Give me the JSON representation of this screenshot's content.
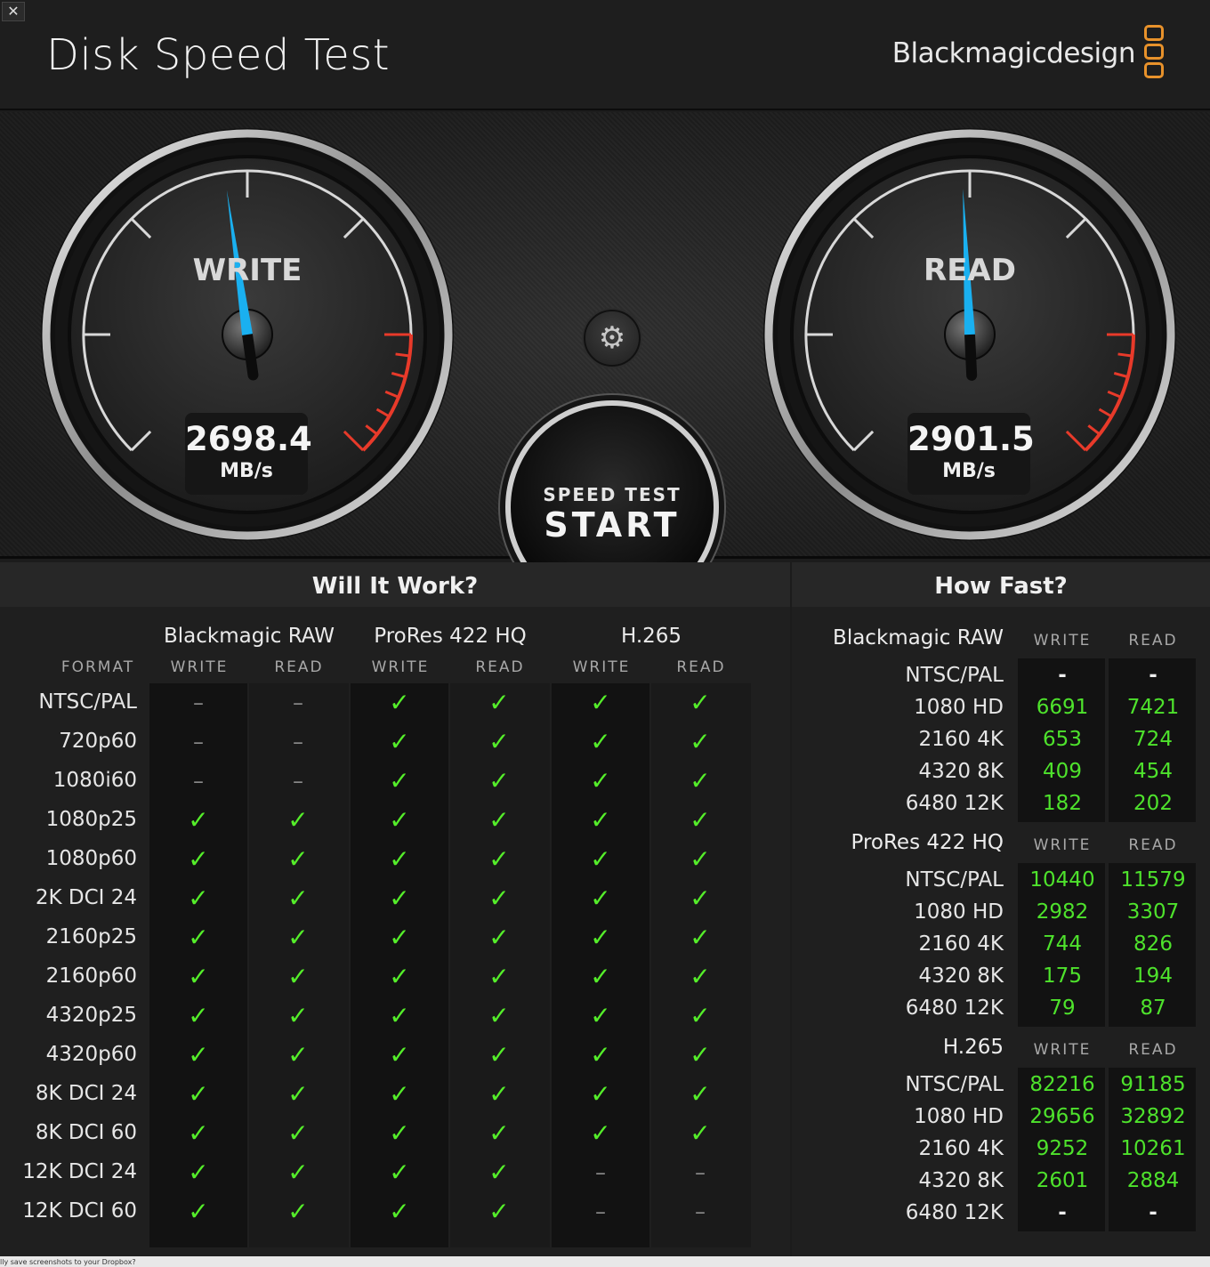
{
  "window": {
    "close_glyph": "✕",
    "title": "Disk Speed Test",
    "brand": "Blackmagicdesign"
  },
  "gauges": {
    "write": {
      "label": "WRITE",
      "value": "2698.4",
      "unit": "MB/s",
      "needle_fraction": 0.47
    },
    "read": {
      "label": "READ",
      "value": "2901.5",
      "unit": "MB/s",
      "needle_fraction": 0.49
    }
  },
  "controls": {
    "settings_icon": "gear-icon",
    "settings_glyph": "⚙",
    "start_line1": "SPEED TEST",
    "start_line2": "START"
  },
  "colors": {
    "needle": "#1ab0f0",
    "check": "#55ee2a",
    "value": "#4ee22c",
    "redline": "#e83a2a",
    "logo": "#e8922b"
  },
  "will_it_work": {
    "title": "Will It Work?",
    "format_label": "FORMAT",
    "codecs": [
      {
        "name": "Blackmagic RAW",
        "write": "WRITE",
        "read": "READ"
      },
      {
        "name": "ProRes 422 HQ",
        "write": "WRITE",
        "read": "READ"
      },
      {
        "name": "H.265",
        "write": "WRITE",
        "read": "READ"
      }
    ],
    "rows": [
      {
        "format": "NTSC/PAL",
        "cells": [
          "–",
          "–",
          "✓",
          "✓",
          "✓",
          "✓"
        ]
      },
      {
        "format": "720p60",
        "cells": [
          "–",
          "–",
          "✓",
          "✓",
          "✓",
          "✓"
        ]
      },
      {
        "format": "1080i60",
        "cells": [
          "–",
          "–",
          "✓",
          "✓",
          "✓",
          "✓"
        ]
      },
      {
        "format": "1080p25",
        "cells": [
          "✓",
          "✓",
          "✓",
          "✓",
          "✓",
          "✓"
        ]
      },
      {
        "format": "1080p60",
        "cells": [
          "✓",
          "✓",
          "✓",
          "✓",
          "✓",
          "✓"
        ]
      },
      {
        "format": "2K DCI 24",
        "cells": [
          "✓",
          "✓",
          "✓",
          "✓",
          "✓",
          "✓"
        ]
      },
      {
        "format": "2160p25",
        "cells": [
          "✓",
          "✓",
          "✓",
          "✓",
          "✓",
          "✓"
        ]
      },
      {
        "format": "2160p60",
        "cells": [
          "✓",
          "✓",
          "✓",
          "✓",
          "✓",
          "✓"
        ]
      },
      {
        "format": "4320p25",
        "cells": [
          "✓",
          "✓",
          "✓",
          "✓",
          "✓",
          "✓"
        ]
      },
      {
        "format": "4320p60",
        "cells": [
          "✓",
          "✓",
          "✓",
          "✓",
          "✓",
          "✓"
        ]
      },
      {
        "format": "8K DCI 24",
        "cells": [
          "✓",
          "✓",
          "✓",
          "✓",
          "✓",
          "✓"
        ]
      },
      {
        "format": "8K DCI 60",
        "cells": [
          "✓",
          "✓",
          "✓",
          "✓",
          "✓",
          "✓"
        ]
      },
      {
        "format": "12K DCI 24",
        "cells": [
          "✓",
          "✓",
          "✓",
          "✓",
          "–",
          "–"
        ]
      },
      {
        "format": "12K DCI 60",
        "cells": [
          "✓",
          "✓",
          "✓",
          "✓",
          "–",
          "–"
        ]
      }
    ]
  },
  "how_fast": {
    "title": "How Fast?",
    "groups": [
      {
        "codec": "Blackmagic RAW",
        "write": "WRITE",
        "read": "READ",
        "rows": [
          {
            "format": "NTSC/PAL",
            "write": "-",
            "read": "-"
          },
          {
            "format": "1080 HD",
            "write": "6691",
            "read": "7421"
          },
          {
            "format": "2160 4K",
            "write": "653",
            "read": "724"
          },
          {
            "format": "4320 8K",
            "write": "409",
            "read": "454"
          },
          {
            "format": "6480 12K",
            "write": "182",
            "read": "202"
          }
        ]
      },
      {
        "codec": "ProRes 422 HQ",
        "write": "WRITE",
        "read": "READ",
        "rows": [
          {
            "format": "NTSC/PAL",
            "write": "10440",
            "read": "11579"
          },
          {
            "format": "1080 HD",
            "write": "2982",
            "read": "3307"
          },
          {
            "format": "2160 4K",
            "write": "744",
            "read": "826"
          },
          {
            "format": "4320 8K",
            "write": "175",
            "read": "194"
          },
          {
            "format": "6480 12K",
            "write": "79",
            "read": "87"
          }
        ]
      },
      {
        "codec": "H.265",
        "write": "WRITE",
        "read": "READ",
        "rows": [
          {
            "format": "NTSC/PAL",
            "write": "82216",
            "read": "91185"
          },
          {
            "format": "1080 HD",
            "write": "29656",
            "read": "32892"
          },
          {
            "format": "2160 4K",
            "write": "9252",
            "read": "10261"
          },
          {
            "format": "4320 8K",
            "write": "2601",
            "read": "2884"
          },
          {
            "format": "6480 12K",
            "write": "-",
            "read": "-"
          }
        ]
      }
    ]
  },
  "footer_notification": "lly save screenshots to your Dropbox?"
}
